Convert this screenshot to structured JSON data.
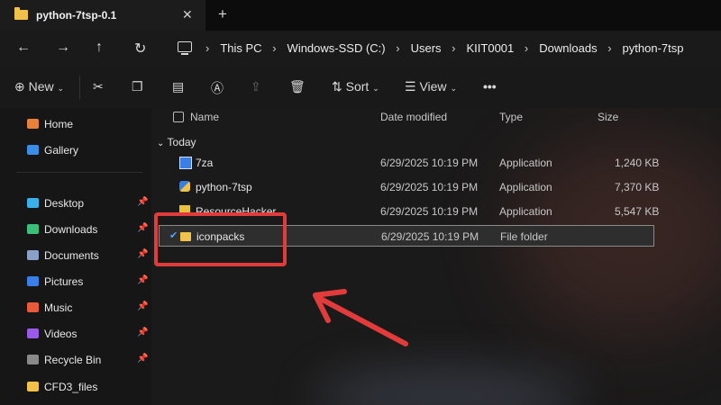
{
  "tab": {
    "title": "python-7tsp-0.1",
    "close_icon": "close-icon",
    "new_tab_icon": "plus-icon"
  },
  "address": {
    "crumbs": [
      "This PC",
      "Windows-SSD (C:)",
      "Users",
      "KIIT0001",
      "Downloads",
      "python-7tsp"
    ]
  },
  "toolbar": {
    "new_label": "New",
    "sort_label": "Sort",
    "view_label": "View",
    "more_label": "•••"
  },
  "sidebar": {
    "items": [
      {
        "label": "Home",
        "icon": "home-icon",
        "color": "#e8813a",
        "pinned": false
      },
      {
        "label": "Gallery",
        "icon": "gallery-icon",
        "color": "#3a8ee8",
        "pinned": false
      },
      {
        "label": "Desktop",
        "icon": "desktop-icon",
        "color": "#3ab0e8",
        "pinned": true
      },
      {
        "label": "Downloads",
        "icon": "download-icon",
        "color": "#3ac07a",
        "pinned": true
      },
      {
        "label": "Documents",
        "icon": "documents-icon",
        "color": "#8aa0c8",
        "pinned": true
      },
      {
        "label": "Pictures",
        "icon": "pictures-icon",
        "color": "#3a7ee8",
        "pinned": true
      },
      {
        "label": "Music",
        "icon": "music-icon",
        "color": "#e85a3a",
        "pinned": true
      },
      {
        "label": "Videos",
        "icon": "videos-icon",
        "color": "#9a5ae8",
        "pinned": true
      },
      {
        "label": "Recycle Bin",
        "icon": "recycle-bin-icon",
        "color": "#8a8a8a",
        "pinned": true
      },
      {
        "label": "CFD3_files",
        "icon": "folder-icon",
        "color": "#f0c24a",
        "pinned": false
      }
    ]
  },
  "columns": {
    "name": "Name",
    "date": "Date modified",
    "type": "Type",
    "size": "Size"
  },
  "group": {
    "label": "Today"
  },
  "files": [
    {
      "name": "7za",
      "date": "6/29/2025 10:19 PM",
      "type": "Application",
      "size": "1,240 KB",
      "icon": "application-icon",
      "color": "#3a7ee8"
    },
    {
      "name": "python-7tsp",
      "date": "6/29/2025 10:19 PM",
      "type": "Application",
      "size": "7,370 KB",
      "icon": "python-icon",
      "color": "#f0c24a"
    },
    {
      "name": "ResourceHacker",
      "date": "6/29/2025 10:19 PM",
      "type": "Application",
      "size": "5,547 KB",
      "icon": "resource-hacker-icon",
      "color": "#e8c23a"
    },
    {
      "name": "iconpacks",
      "date": "6/29/2025 10:19 PM",
      "type": "File folder",
      "size": "",
      "icon": "folder-icon",
      "color": "#f0c24a"
    }
  ],
  "accent": "#e23b3b"
}
